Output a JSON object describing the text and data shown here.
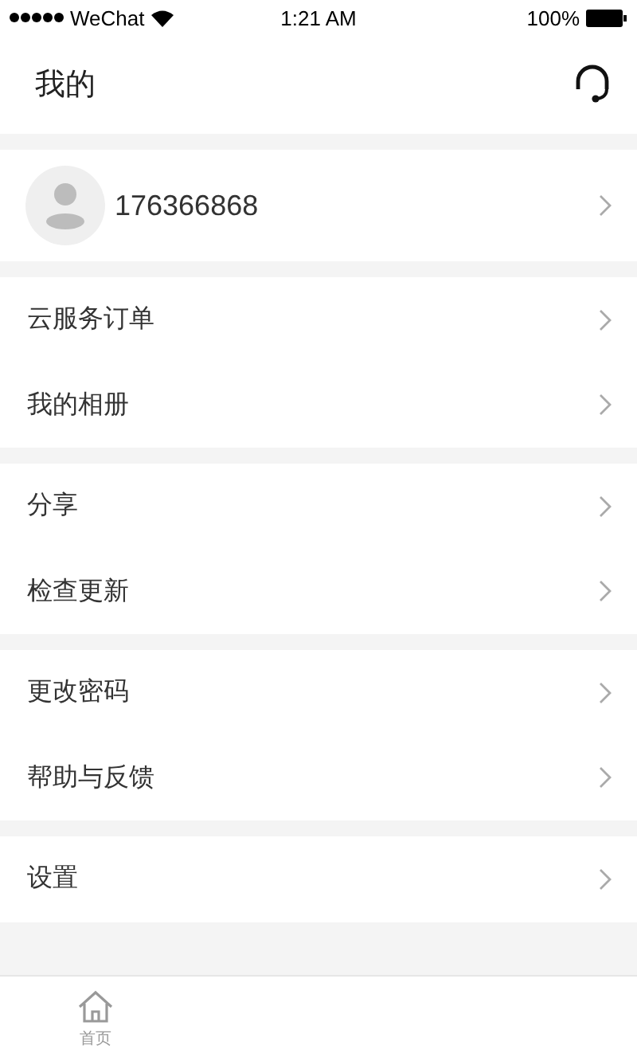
{
  "status_bar": {
    "carrier": "WeChat",
    "time": "1:21 AM",
    "battery": "100%"
  },
  "header": {
    "title": "我的"
  },
  "profile": {
    "account": "176366868"
  },
  "menu_groups": [
    {
      "items": [
        "云服务订单",
        "我的相册"
      ]
    },
    {
      "items": [
        "分享",
        "检查更新"
      ]
    },
    {
      "items": [
        "更改密码",
        "帮助与反馈"
      ]
    },
    {
      "items": [
        "设置"
      ]
    }
  ],
  "tab_bar": [
    {
      "label": "首页",
      "selected": false
    }
  ]
}
